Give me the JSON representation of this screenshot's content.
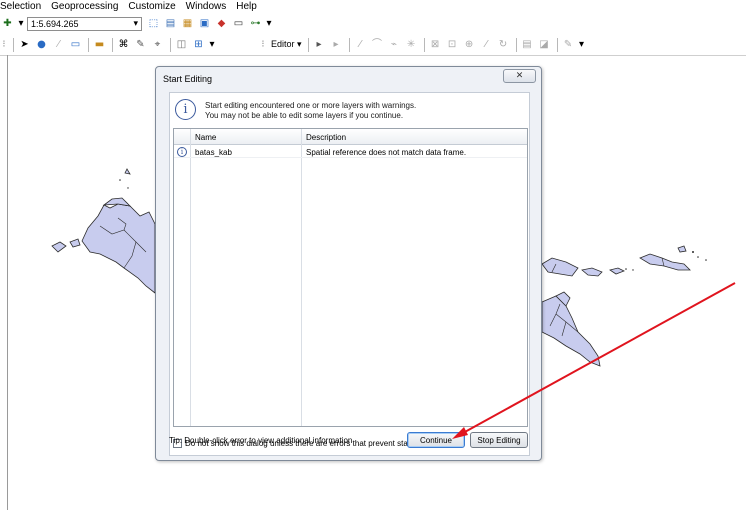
{
  "menu": {
    "items": [
      "Selection",
      "Geoprocessing",
      "Customize",
      "Windows",
      "Help"
    ]
  },
  "toolbar": {
    "scale_value": "1:5.694.265",
    "editor_label": "Editor ▾"
  },
  "dialog": {
    "title": "Start Editing",
    "warning_line1": "Start editing encountered one or more layers with warnings.",
    "warning_line2": "You may not be able to edit some layers if you continue.",
    "columns": [
      "Name",
      "Description"
    ],
    "rows": [
      {
        "name": "batas_kab",
        "description": "Spatial reference does not match data frame."
      }
    ],
    "checkbox_label": "Do not show this dialog unless there are errors that prevent start editing.",
    "tip": "Tip: Double-click error to view additional information",
    "continue_label": "Continue",
    "stop_label": "Stop Editing"
  },
  "colors": {
    "map_fill": "#c8ccee",
    "map_stroke": "#2b2b2b",
    "annotation": "#e0141e",
    "info_blue": "#3b5a9d"
  },
  "icons": {
    "dialog": "info-icon",
    "row": "info-icon",
    "close": "close-icon"
  }
}
